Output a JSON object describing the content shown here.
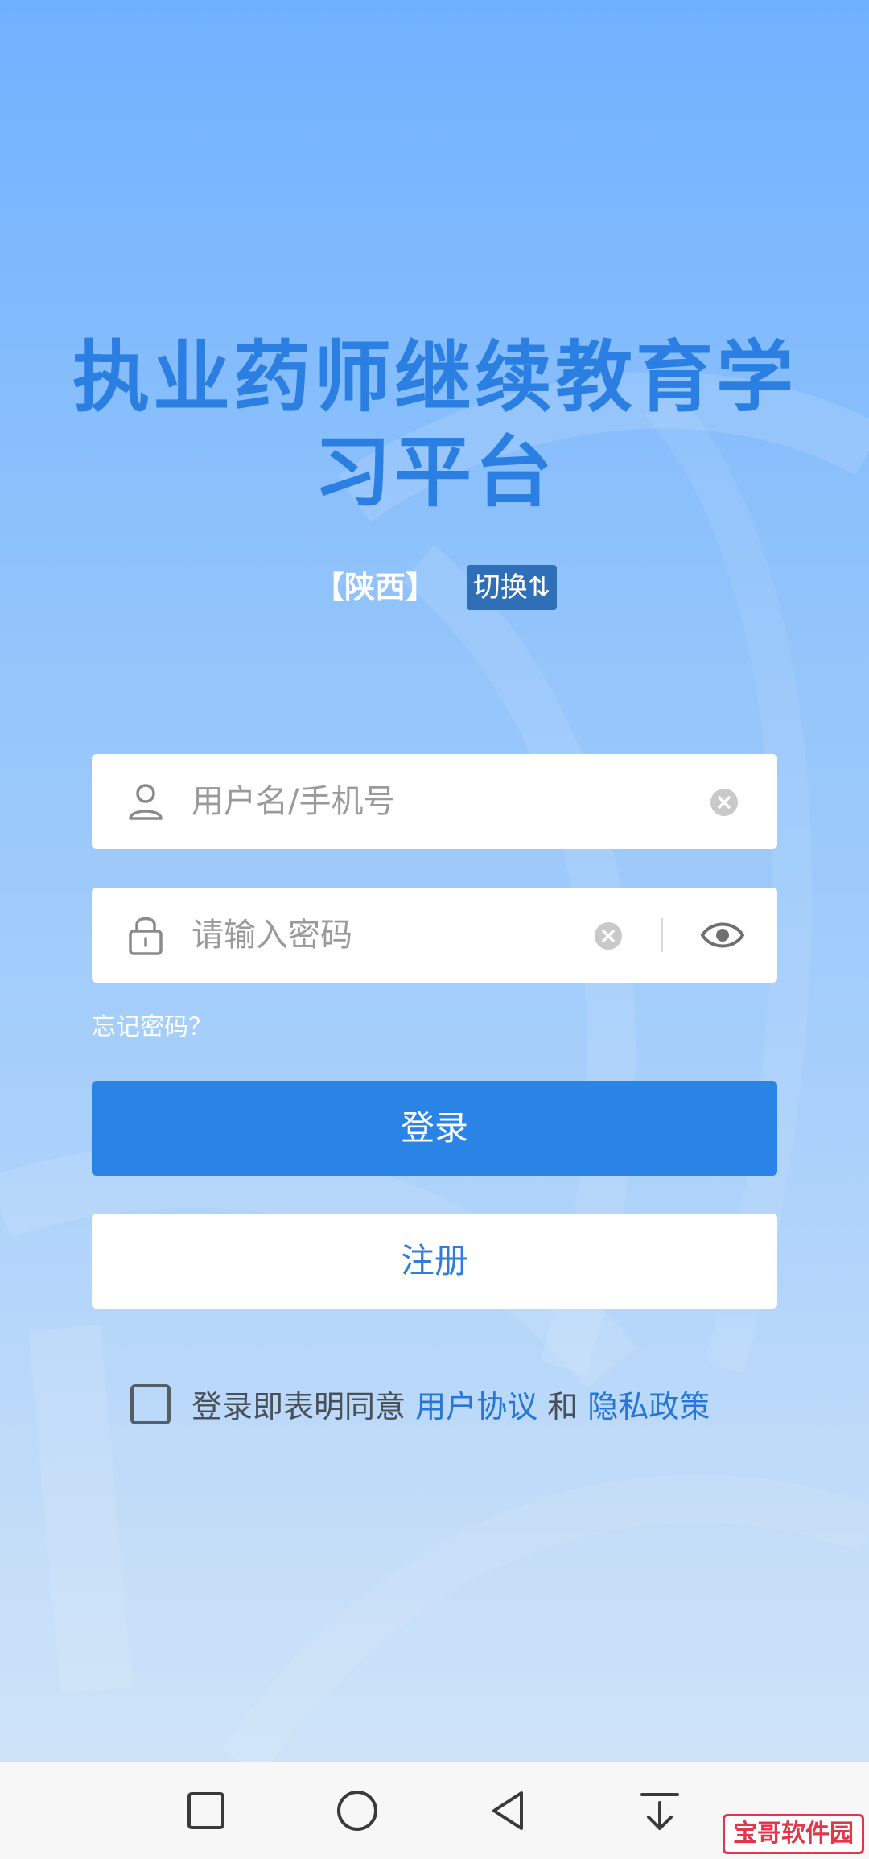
{
  "app": {
    "title_line1": "执业药师继续教育学",
    "title_line2": "习平台"
  },
  "region": {
    "name": "【陕西】",
    "switch_label": "切换⇅"
  },
  "form": {
    "username_placeholder": "用户名/手机号",
    "password_placeholder": "请输入密码",
    "forgot_label": "忘记密码？",
    "login_label": "登录",
    "register_label": "注册"
  },
  "agreement": {
    "prefix": "登录即表明同意 ",
    "user_agreement": "用户协议",
    "and": " 和 ",
    "privacy_policy": "隐私政策",
    "checked": false
  },
  "navbar": {
    "buttons": [
      "recent-apps-icon",
      "home-icon",
      "back-icon",
      "notification-pull-icon"
    ]
  },
  "watermark": {
    "text": "宝哥软件园"
  },
  "colors": {
    "title": "#2b7fe3",
    "primary_button": "#2a84e6",
    "link": "#2576d8",
    "switch_bg": "#2f6fb8"
  }
}
